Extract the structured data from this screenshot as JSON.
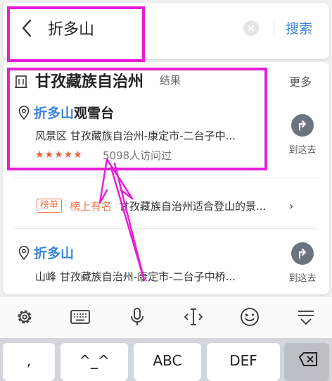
{
  "search": {
    "query": "折多山",
    "button_label": "搜索"
  },
  "region": {
    "title": "甘孜藏族自治州",
    "tag": "结果",
    "more": "更多"
  },
  "poi1": {
    "name_highlight": "折多山",
    "name_rest": "观雪台",
    "address": "风景区  甘孜藏族自治州-康定市-二台子中...",
    "rating_stars": "★★★★★",
    "visits": "5098人访问过",
    "go_label": "到这去"
  },
  "ranking": {
    "badge": "榜单",
    "lead": "榜上有名",
    "text": "甘孜藏族自治州适合登山的景...",
    "chevron": "›"
  },
  "poi2": {
    "name_highlight": "折多山",
    "address": "山峰  甘孜藏族自治州-康定市-二台子中桥...",
    "go_label": "到这去"
  },
  "keyboard_toolbar": [
    "gear-icon",
    "keyboard-icon",
    "microphone-icon",
    "text-cursor-icon",
    "emoji-icon",
    "collapse-keyboard-icon"
  ],
  "keyboard": {
    "keys": [
      ",",
      "^_^",
      "ABC",
      "DEF"
    ],
    "backspace_icon": "backspace-icon"
  },
  "colors": {
    "highlight": "#3a85e0",
    "annotation": "#e81fd6",
    "rating": "#f25a3c",
    "ranking": "#f07a4a"
  }
}
